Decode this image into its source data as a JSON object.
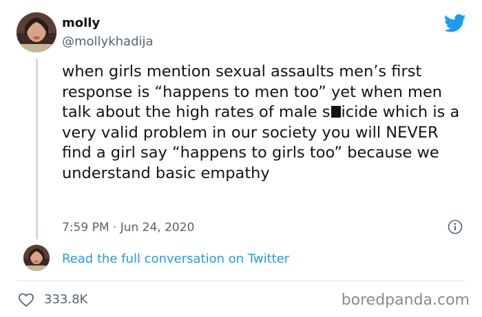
{
  "tweet": {
    "display_name": "molly",
    "handle": "@mollykhadija",
    "text_before_redaction": "when girls mention sexual assaults men’s first response is “happens to men too” yet when men talk about the high rates of male s",
    "text_after_redaction": "icide which is a very valid problem in our society you will NEVER find a girl say “happens to girls too” because we understand basic empathy",
    "timestamp": "7:59 PM · Jun 24, 2020",
    "read_conversation": "Read the full conversation on Twitter",
    "like_count": "333.8K"
  },
  "watermark": "boredpanda.com",
  "icons": {
    "brand": "twitter-bird-icon",
    "info": "info-icon",
    "like": "heart-icon"
  },
  "colors": {
    "twitter_blue": "#1d9bf0",
    "text_primary": "#0f1419",
    "text_secondary": "#536471",
    "thread_line": "#cfd9de"
  }
}
